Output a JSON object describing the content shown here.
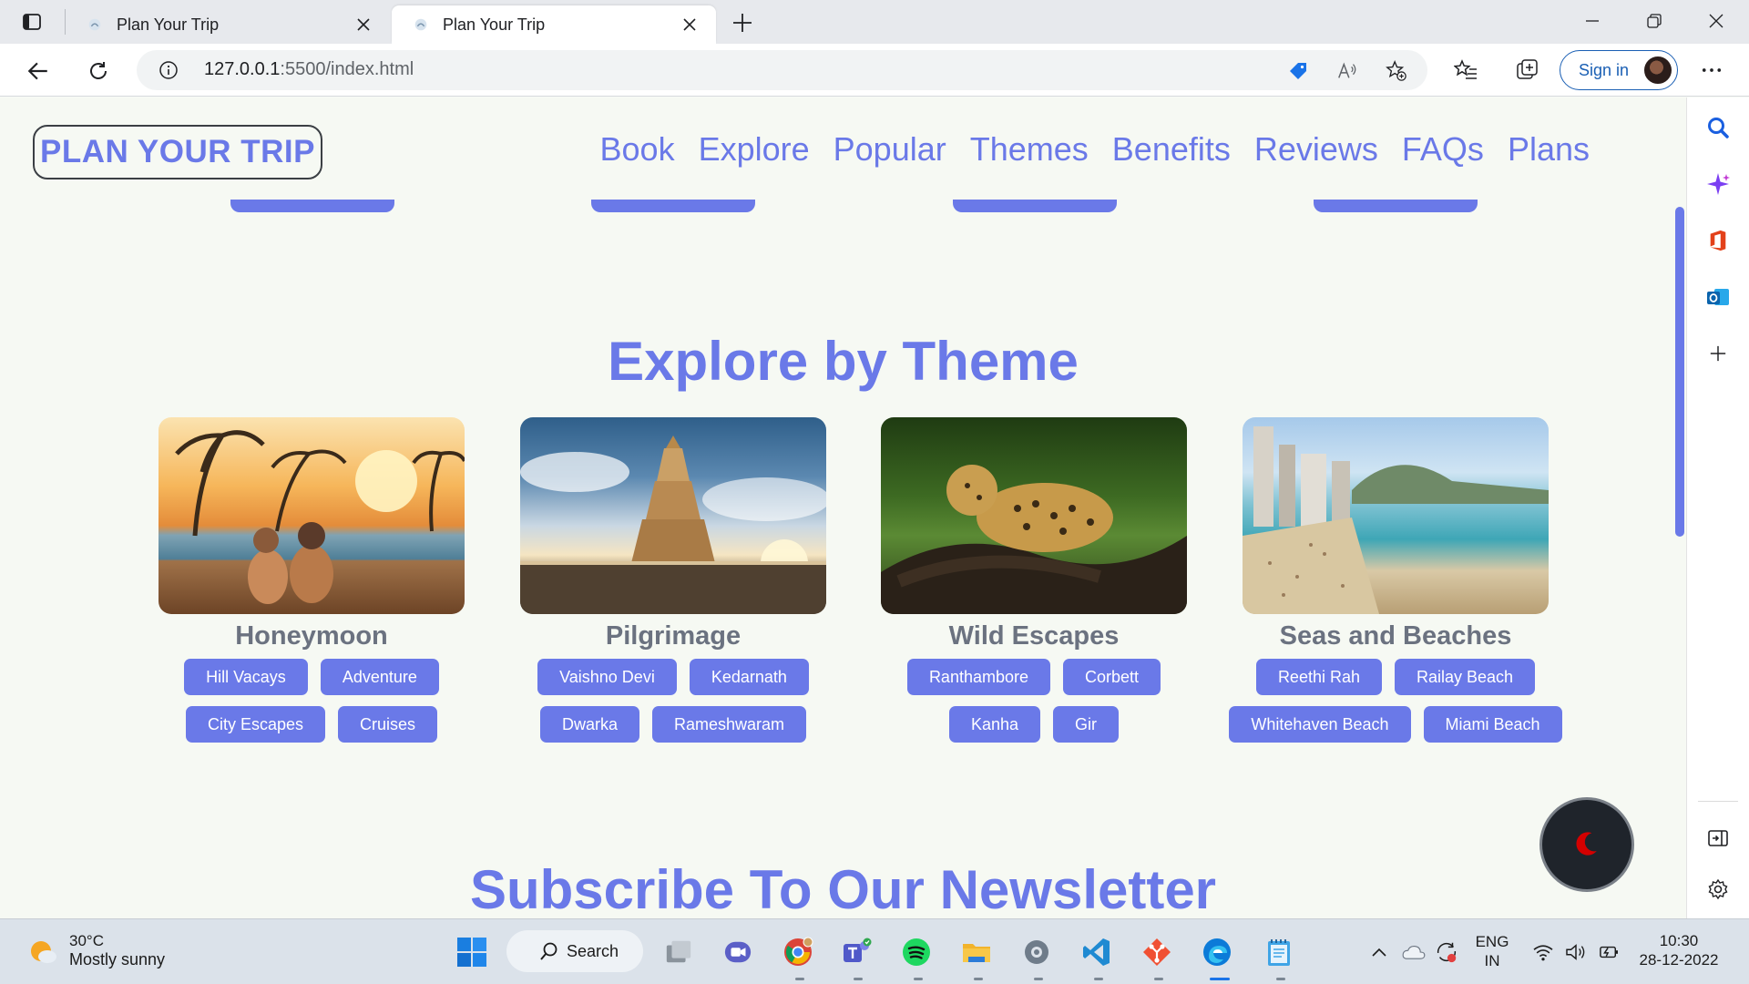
{
  "browser": {
    "tabs": [
      {
        "title": "Plan Your Trip",
        "active": false
      },
      {
        "title": "Plan Your Trip",
        "active": true
      }
    ],
    "url_host": "127.0.0.1",
    "url_rest": ":5500/index.html",
    "signin_label": "Sign in"
  },
  "site": {
    "logo": "PLAN YOUR TRIP",
    "nav": [
      "Book",
      "Explore",
      "Popular",
      "Themes",
      "Benefits",
      "Reviews",
      "FAQs",
      "Plans"
    ],
    "explore_title": "Explore by Theme",
    "newsletter_title": "Subscribe To Our Newsletter",
    "themes": [
      {
        "name": "Honeymoon",
        "tags": [
          "Hill Vacays",
          "Adventure",
          "City Escapes",
          "Cruises"
        ]
      },
      {
        "name": "Pilgrimage",
        "tags": [
          "Vaishno Devi",
          "Kedarnath",
          "Dwarka",
          "Rameshwaram"
        ]
      },
      {
        "name": "Wild Escapes",
        "tags": [
          "Ranthambore",
          "Corbett",
          "Kanha",
          "Gir"
        ]
      },
      {
        "name": "Seas and Beaches",
        "tags": [
          "Reethi Rah",
          "Railay Beach",
          "Whitehaven Beach",
          "Miami Beach"
        ]
      }
    ],
    "accent_color": "#6a79e8"
  },
  "taskbar": {
    "weather_temp": "30°C",
    "weather_desc": "Mostly sunny",
    "search_label": "Search",
    "lang_line1": "ENG",
    "lang_line2": "IN",
    "time": "10:30",
    "date": "28-12-2022"
  }
}
